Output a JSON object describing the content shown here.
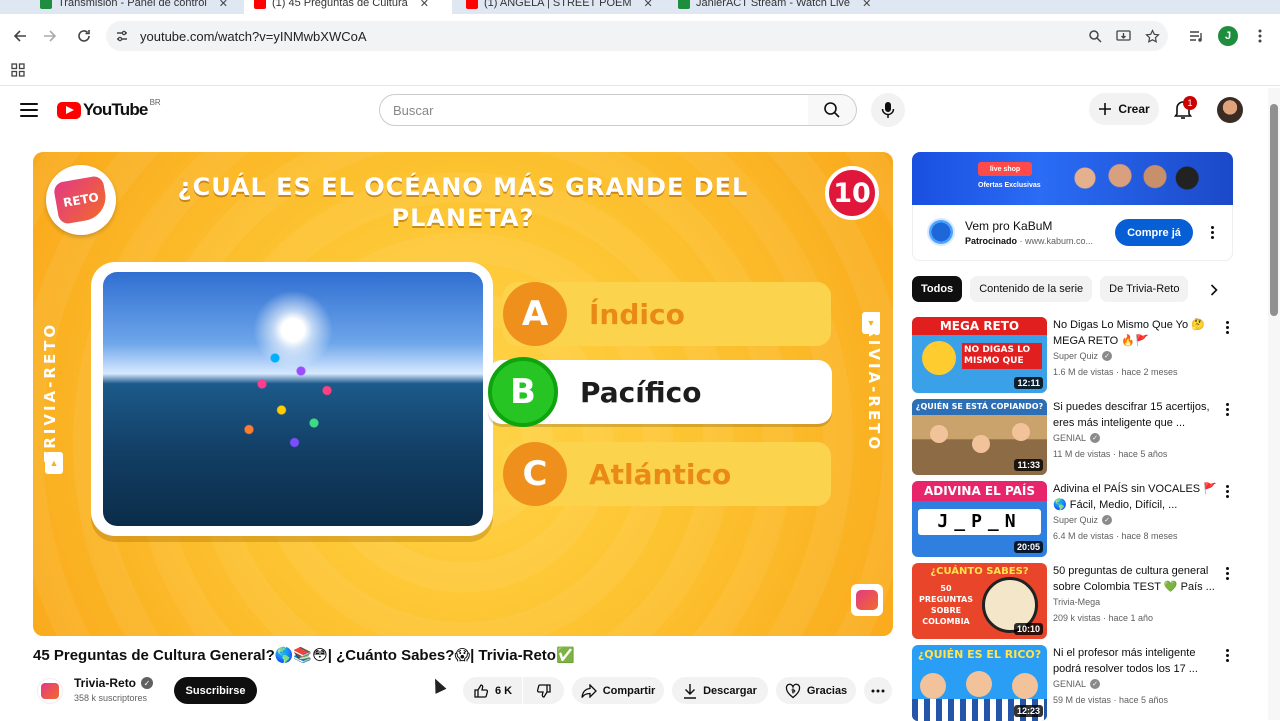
{
  "browser": {
    "tabs": [
      {
        "label": "Transmisión - Panel de control",
        "color": "#1e8e3e"
      },
      {
        "label": "(1) 45 Preguntas de Cultura",
        "color": "#ff0000",
        "active": true
      },
      {
        "label": "(1) ANGELA | STREET POEM",
        "color": "#ff0000"
      },
      {
        "label": "JanlerACT Stream - Watch Live",
        "color": "#1e8e3e"
      }
    ],
    "url": "youtube.com/watch?v=yINMwbXWCoA",
    "profile_initial": "J"
  },
  "youtube": {
    "logo_text": "YouTube",
    "country": "BR",
    "search_placeholder": "Buscar",
    "create_label": "Crear",
    "notification_count": "1"
  },
  "video": {
    "question": "¿CUÁL ES EL OCÉANO MÁS GRANDE DEL PLANETA?",
    "counter": "10",
    "channel_badge": "RETO",
    "side_text": "TRIVIA-RETO",
    "answers": [
      {
        "letter": "A",
        "text": "Índico"
      },
      {
        "letter": "B",
        "text": "Pacífico"
      },
      {
        "letter": "C",
        "text": "Atlántico"
      }
    ],
    "title": "45 Preguntas de Cultura General?🌎📚😳| ¿Cuánto Sabes?😱| Trivia-Reto✅",
    "channel": "Trivia-Reto",
    "subscribers": "358 k suscriptores",
    "subscribe_label": "Suscribirse",
    "likes": "6 K",
    "share_label": "Compartir",
    "download_label": "Descargar",
    "thanks_label": "Gracias"
  },
  "ad": {
    "shop_badge": "live shop",
    "offers": "Ofertas Exclusivas",
    "title": "Vem pro KaBuM",
    "sponsored": "Patrocinado",
    "domain": "www.kabum.co...",
    "cta": "Compre já"
  },
  "chips": [
    "Todos",
    "Contenido de la serie",
    "De Trivia-Reto"
  ],
  "recommendations": [
    {
      "thumb_text": "MEGA RETO",
      "thumb_sub": "NO DIGAS LO MISMO QUE",
      "thumb_bg": "#3aa0e8",
      "title": "No Digas Lo Mismo Que Yo 🤔 MEGA RETO 🔥🚩",
      "channel": "Super Quiz",
      "meta": "1.6 M de vistas · hace 2 meses",
      "duration": "12:11"
    },
    {
      "thumb_text": "¿QUIÉN SE ESTÁ COPIANDO?",
      "thumb_sub": "",
      "thumb_bg": "#7fb36a",
      "title": "Si puedes descifrar 15 acertijos, eres más inteligente que ...",
      "channel": "GENIAL",
      "meta": "11 M de vistas · hace 5 años",
      "duration": "11:33"
    },
    {
      "thumb_text": "ADIVINA EL PAÍS",
      "thumb_sub": "J_P_N",
      "thumb_bg": "#2f7fe0",
      "title": "Adivina el PAÍS sin VOCALES 🚩🌎 Fácil, Medio, Difícil, ...",
      "channel": "Super Quiz",
      "meta": "6.4 M de vistas · hace 8 meses",
      "duration": "20:05"
    },
    {
      "thumb_text": "¿CUÁNTO SABES?",
      "thumb_sub": "50 PREGUNTAS SOBRE COLOMBIA",
      "thumb_bg": "#e8452b",
      "title": "50 preguntas de cultura general sobre Colombia TEST 💚 País ...",
      "channel": "Trivia-Mega",
      "meta": "209 k vistas · hace 1 año",
      "duration": "10:10"
    },
    {
      "thumb_text": "¿QUIÉN ES EL RICO?",
      "thumb_sub": "",
      "thumb_bg": "#2a9df4",
      "title": "Ni el profesor más inteligente podrá resolver todos los 17 ...",
      "channel": "GENIAL",
      "meta": "59 M de vistas · hace 5 años",
      "duration": "12:23"
    }
  ]
}
